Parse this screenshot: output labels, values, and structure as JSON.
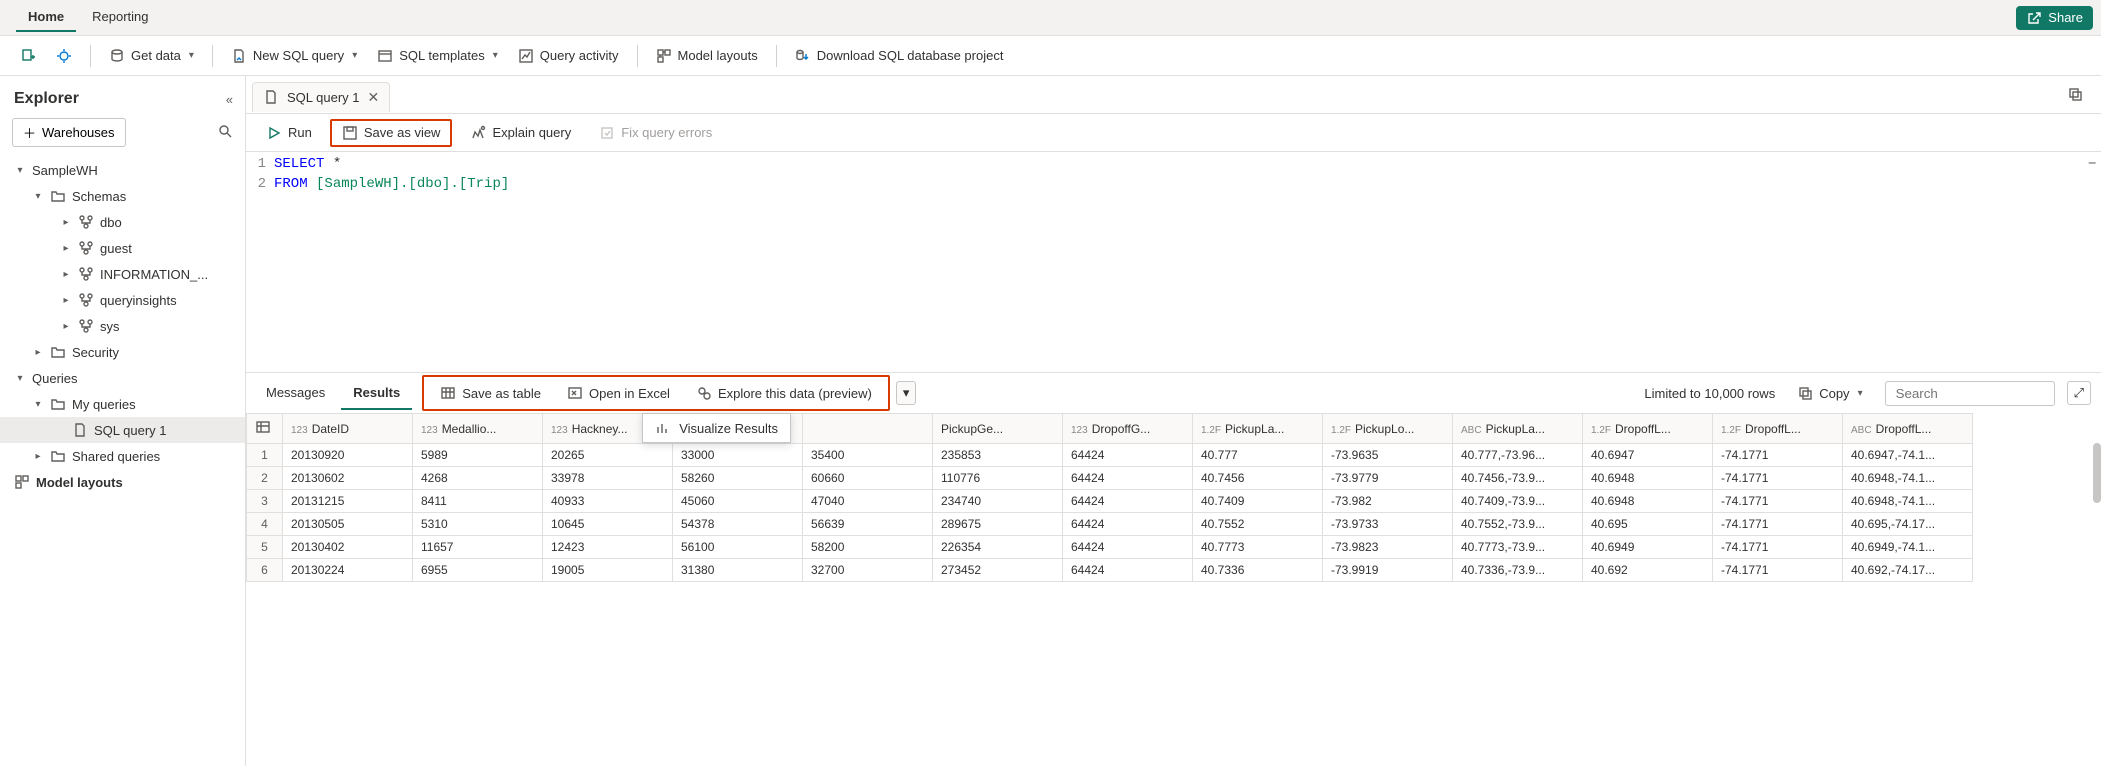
{
  "topTabs": {
    "home": "Home",
    "reporting": "Reporting"
  },
  "share": "Share",
  "toolbar": {
    "get_data": "Get data",
    "new_sql": "New SQL query",
    "sql_templates": "SQL templates",
    "query_activity": "Query activity",
    "model_layouts": "Model layouts",
    "download_project": "Download SQL database project"
  },
  "explorer": {
    "title": "Explorer",
    "warehouses": "Warehouses",
    "tree": {
      "samplewh": "SampleWH",
      "schemas": "Schemas",
      "dbo": "dbo",
      "guest": "guest",
      "info": "INFORMATION_...",
      "queryinsights": "queryinsights",
      "sys": "sys",
      "security": "Security",
      "queries": "Queries",
      "my_queries": "My queries",
      "sql_query_1": "SQL query 1",
      "shared_queries": "Shared queries",
      "model_layouts": "Model layouts"
    }
  },
  "editor": {
    "tab_title": "SQL query 1",
    "toolbar": {
      "run": "Run",
      "save_view": "Save as view",
      "explain": "Explain query",
      "fix_errors": "Fix query errors"
    },
    "code": {
      "l1a": "SELECT",
      "l1b": " *",
      "l2a": "FROM",
      "l2b": " [SampleWH].[dbo].[Trip]"
    },
    "lines": {
      "n1": "1",
      "n2": "2"
    }
  },
  "results": {
    "tabs": {
      "messages": "Messages",
      "results": "Results"
    },
    "actions": {
      "save_table": "Save as table",
      "open_excel": "Open in Excel",
      "explore": "Explore this data (preview)",
      "visualize": "Visualize Results"
    },
    "limit": "Limited to 10,000 rows",
    "copy": "Copy",
    "search_placeholder": "Search",
    "columns": [
      {
        "type": "123",
        "name": "DateID"
      },
      {
        "type": "123",
        "name": "Medallio..."
      },
      {
        "type": "123",
        "name": "Hackney..."
      },
      {
        "type": "123",
        "name": "Pick"
      },
      {
        "type": "",
        "name": ""
      },
      {
        "type": "",
        "name": "PickupGe..."
      },
      {
        "type": "123",
        "name": "DropoffG..."
      },
      {
        "type": "1.2F",
        "name": "PickupLa..."
      },
      {
        "type": "1.2F",
        "name": "PickupLo..."
      },
      {
        "type": "ABC",
        "name": "PickupLa..."
      },
      {
        "type": "1.2F",
        "name": "DropoffL..."
      },
      {
        "type": "1.2F",
        "name": "DropoffL..."
      },
      {
        "type": "ABC",
        "name": "DropoffL..."
      }
    ],
    "rows": [
      [
        "1",
        "20130920",
        "5989",
        "20265",
        "33000",
        "35400",
        "235853",
        "64424",
        "40.777",
        "-73.9635",
        "40.777,-73.96...",
        "40.6947",
        "-74.1771",
        "40.6947,-74.1..."
      ],
      [
        "2",
        "20130602",
        "4268",
        "33978",
        "58260",
        "60660",
        "110776",
        "64424",
        "40.7456",
        "-73.9779",
        "40.7456,-73.9...",
        "40.6948",
        "-74.1771",
        "40.6948,-74.1..."
      ],
      [
        "3",
        "20131215",
        "8411",
        "40933",
        "45060",
        "47040",
        "234740",
        "64424",
        "40.7409",
        "-73.982",
        "40.7409,-73.9...",
        "40.6948",
        "-74.1771",
        "40.6948,-74.1..."
      ],
      [
        "4",
        "20130505",
        "5310",
        "10645",
        "54378",
        "56639",
        "289675",
        "64424",
        "40.7552",
        "-73.9733",
        "40.7552,-73.9...",
        "40.695",
        "-74.1771",
        "40.695,-74.17..."
      ],
      [
        "5",
        "20130402",
        "11657",
        "12423",
        "56100",
        "58200",
        "226354",
        "64424",
        "40.7773",
        "-73.9823",
        "40.7773,-73.9...",
        "40.6949",
        "-74.1771",
        "40.6949,-74.1..."
      ],
      [
        "6",
        "20130224",
        "6955",
        "19005",
        "31380",
        "32700",
        "273452",
        "64424",
        "40.7336",
        "-73.9919",
        "40.7336,-73.9...",
        "40.692",
        "-74.1771",
        "40.692,-74.17..."
      ]
    ]
  }
}
